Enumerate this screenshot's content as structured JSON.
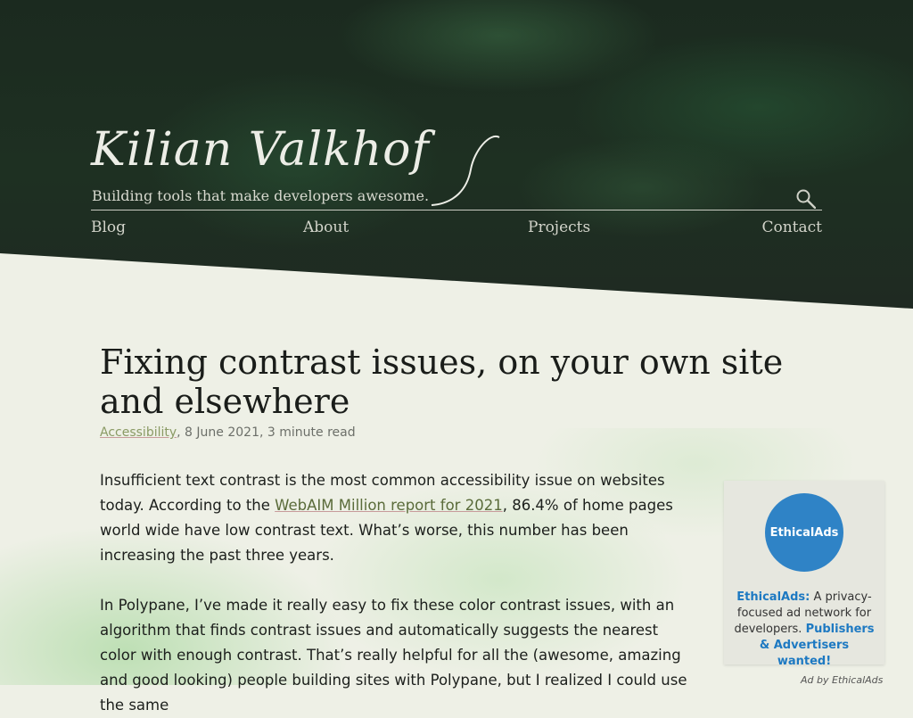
{
  "header": {
    "logo_text": "Kilian Valkhof",
    "tagline": "Building tools that make developers awesome.",
    "search_icon": "search-icon"
  },
  "nav": {
    "items": [
      {
        "label": "Blog"
      },
      {
        "label": "About"
      },
      {
        "label": "Projects"
      },
      {
        "label": "Contact"
      }
    ]
  },
  "article": {
    "title": "Fixing contrast issues, on your own site and elsewhere",
    "category": "Accessibility",
    "meta_rest": ", 8 June 2021, 3 minute read",
    "p1_before": "Insufficient text contrast is the most common accessibility issue on websites today. According to the ",
    "p1_link": "WebAIM Million report for 2021",
    "p1_after": ", 86.4% of home pages world wide have low contrast text. What’s worse, this number has been increasing the past three years.",
    "p2": "In Polypane, I’ve made it really easy to fix these color contrast issues, with an algorithm that finds contrast issues and automatically suggests the nearest color with enough contrast. That’s really helpful for all the (awesome, amazing and good looking) people building sites with Polypane, but I realized I could use the same"
  },
  "ad": {
    "logo_text": "EthicalAds",
    "brand": "EthicalAds:",
    "body": " A privacy-focused ad network for developers. ",
    "cta": "Publishers & Advertisers wanted!",
    "attribution": "Ad by EthicalAds"
  },
  "colors": {
    "header_bg": "#1e3022",
    "page_bg": "#eef0e6",
    "link_underline": "#c79b9b",
    "ad_blue": "#2f83c6"
  }
}
